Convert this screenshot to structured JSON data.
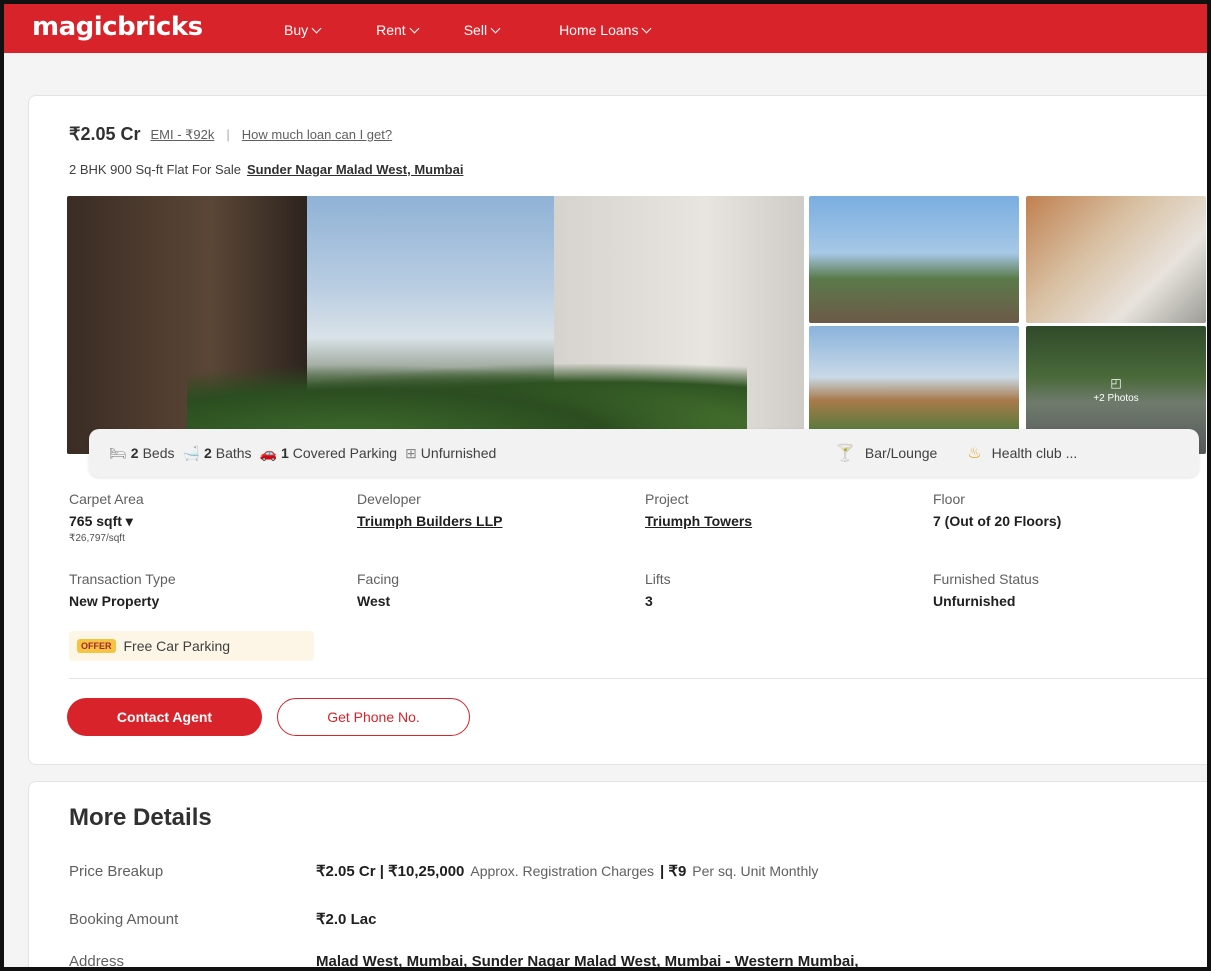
{
  "header": {
    "logo": "magicbricks",
    "nav": [
      {
        "label": "Buy"
      },
      {
        "label": "Rent"
      },
      {
        "label": "Sell"
      },
      {
        "label": "Home Loans"
      }
    ]
  },
  "listing": {
    "price": "₹2.05 Cr",
    "emi": "EMI - ₹92k",
    "separator": "|",
    "loan_link": "How much loan can I get?",
    "summary": "2 BHK 900 Sq-ft Flat For Sale",
    "location": "Sunder Nagar Malad West, Mumbai",
    "more_photos": "+2 Photos",
    "features": {
      "beds_num": "2",
      "beds_label": "Beds",
      "baths_num": "2",
      "baths_label": "Baths",
      "parking_num": "1",
      "parking_label": "Covered Parking",
      "furnish": "Unfurnished"
    },
    "amenities": [
      "Bar/Lounge",
      "Health club ..."
    ],
    "details": {
      "carpet_area_label": "Carpet Area",
      "carpet_area_value": "765 sqft ▾",
      "carpet_area_rate": "₹26,797/sqft",
      "developer_label": "Developer",
      "developer_value": "Triumph Builders LLP",
      "project_label": "Project",
      "project_value": "Triumph Towers",
      "floor_label": "Floor",
      "floor_value": "7 (Out of 20 Floors)",
      "transaction_label": "Transaction Type",
      "transaction_value": "New Property",
      "facing_label": "Facing",
      "facing_value": "West",
      "lifts_label": "Lifts",
      "lifts_value": "3",
      "furnished_label": "Furnished Status",
      "furnished_value": "Unfurnished"
    },
    "offer_tag": "OFFER",
    "offer_text": "Free Car Parking",
    "contact_button": "Contact Agent",
    "phone_button": "Get Phone No."
  },
  "more_details": {
    "title": "More Details",
    "price_breakup_label": "Price Breakup",
    "price_breakup_price": "₹2.05 Cr | ₹10,25,000",
    "price_breakup_note1": "Approx. Registration Charges",
    "price_breakup_mid": "| ₹9",
    "price_breakup_note2": "Per sq. Unit Monthly",
    "booking_label": "Booking Amount",
    "booking_value": "₹2.0 Lac",
    "address_label": "Address",
    "address_value": "Malad West, Mumbai, Sunder Nagar Malad West, Mumbai - Western Mumbai,"
  },
  "colors": {
    "brand_red": "#d8232a",
    "offer_tag_bg": "#f5c443",
    "offer_bg": "#fdf6e7"
  },
  "icons": [
    "chevron-down-icon",
    "bed-icon",
    "bath-icon",
    "car-icon",
    "furniture-icon",
    "bar-icon",
    "health-club-icon",
    "photos-icon"
  ]
}
